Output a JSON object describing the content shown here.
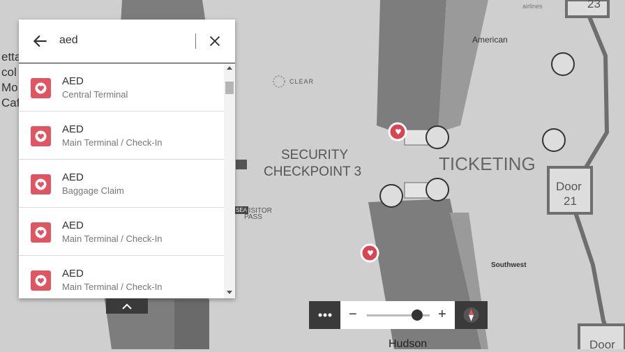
{
  "map": {
    "labels": {
      "security_checkpoint": "SECURITY",
      "security_checkpoint_line2": "CHECKPOINT 3",
      "ticketing": "TICKETING",
      "door_21": "Door",
      "door_21_num": "21",
      "door_top": "23",
      "door_bottom": "Door",
      "clear": "CLEAR",
      "american": "American",
      "southwest": "Southwest",
      "alaska": "airlines",
      "visitor_pass_sea": "SEA",
      "visitor_pass": "VISITOR",
      "visitor_pass_2": "PASS",
      "hudson": "Hudson",
      "cafe_partial_1": "etta",
      "cafe_partial_2": "col",
      "cafe_partial_3": "Mo",
      "cafe_partial_4": "Caf"
    },
    "colors": {
      "background": "#cfcfcf",
      "concourse": "#7a7a7a",
      "aed_marker": "#d94552",
      "wall": "#6e6e6e"
    }
  },
  "search": {
    "query": "aed",
    "results": [
      {
        "title": "AED",
        "subtitle": "Central Terminal"
      },
      {
        "title": "AED",
        "subtitle": "Main Terminal / Check-In"
      },
      {
        "title": "AED",
        "subtitle": "Baggage Claim"
      },
      {
        "title": "AED",
        "subtitle": "Main Terminal / Check-In"
      },
      {
        "title": "AED",
        "subtitle": "Main Terminal / Check-In"
      }
    ]
  },
  "controls": {
    "zoom_level": 0.8,
    "more_icon": "more-icon",
    "compass_icon": "compass-icon"
  }
}
